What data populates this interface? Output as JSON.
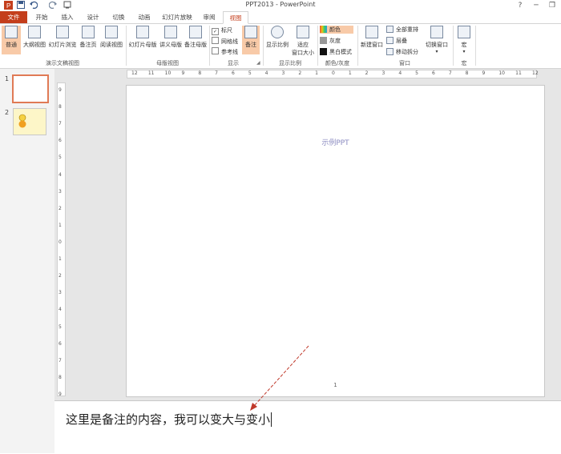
{
  "window": {
    "title": "PPT2013 - PowerPoint",
    "controls": {
      "help": "?",
      "minimize": "─",
      "restore": "❐"
    }
  },
  "quick_access": {
    "app_icon": "powerpoint-icon",
    "save_icon": "save-icon",
    "undo_icon": "undo-icon",
    "redo_icon": "redo-icon",
    "customize_icon": "customize-icon"
  },
  "tabs": {
    "file": "文件",
    "home": "开始",
    "insert": "插入",
    "design": "设计",
    "transitions": "切换",
    "animations": "动画",
    "slideshow": "幻灯片放映",
    "review": "审阅",
    "view": "视图"
  },
  "ribbon": {
    "presentation_views": {
      "label": "演示文稿视图",
      "normal": "普通",
      "outline": "大纲视图",
      "sorter": "幻灯片浏览",
      "notes_page": "备注页",
      "reading": "阅读视图"
    },
    "master_views": {
      "label": "母版视图",
      "slide_master": "幻灯片母版",
      "handout_master": "讲义母版",
      "notes_master": "备注母版"
    },
    "show": {
      "label": "显示",
      "ruler": "标尺",
      "ruler_checked": true,
      "gridlines": "网格线",
      "gridlines_checked": false,
      "guides": "参考线",
      "guides_checked": false,
      "notes": "备注"
    },
    "zoom": {
      "label": "显示比例",
      "zoom": "显示比例",
      "fit_line1": "适应",
      "fit_line2": "窗口大小"
    },
    "color": {
      "label": "颜色/灰度",
      "color": "颜色",
      "grayscale": "灰度",
      "bw": "黑白模式"
    },
    "window": {
      "label": "窗口",
      "new_window": "新建窗口",
      "arrange_all": "全部重排",
      "cascade": "层叠",
      "move_split": "移动拆分",
      "switch_windows": "切换窗口"
    },
    "macros": {
      "label": "宏",
      "macros": "宏"
    }
  },
  "thumbnails": [
    {
      "number": "1"
    },
    {
      "number": "2"
    }
  ],
  "rulers": {
    "horizontal_ticks": [
      "12",
      "11",
      "10",
      "9",
      "8",
      "7",
      "6",
      "5",
      "4",
      "3",
      "2",
      "1",
      "0",
      "1",
      "2",
      "3",
      "4",
      "5",
      "6",
      "7",
      "8",
      "9",
      "10",
      "11",
      "12"
    ],
    "vertical_ticks": [
      "9",
      "8",
      "7",
      "6",
      "5",
      "4",
      "3",
      "2",
      "1",
      "0",
      "1",
      "2",
      "3",
      "4",
      "5",
      "6",
      "7",
      "8",
      "9"
    ]
  },
  "slide": {
    "title": "示例PPT",
    "number": "1"
  },
  "notes": {
    "text": "这里是备注的内容，我可以变大与变小"
  },
  "colors": {
    "accent": "#c43e1c",
    "selected_button": "#f8caa8",
    "annotation_arrow": "#c0392b"
  }
}
